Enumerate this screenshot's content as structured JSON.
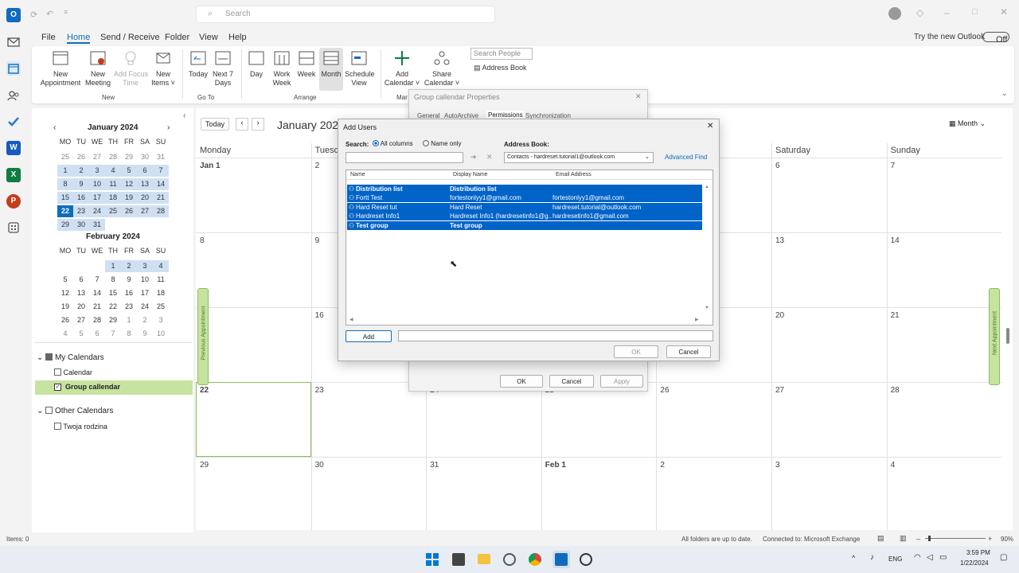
{
  "window": {
    "search_placeholder": "Search"
  },
  "menu": [
    "File",
    "Home",
    "Send / Receive",
    "Folder",
    "View",
    "Help"
  ],
  "try_new": "Try the new Outlook",
  "toggle": "Off",
  "ribbon": {
    "new_appt": "New\nAppointment",
    "new_meeting": "New\nMeeting",
    "focus": "Add Focus\nTime",
    "new_items": "New\nItems ˅",
    "today": "Today",
    "next7": "Next 7\nDays",
    "day": "Day",
    "workweek": "Work\nWeek",
    "week": "Week",
    "month": "Month",
    "schedule": "Schedule\nView",
    "add_cal": "Add\nCalendar ˅",
    "share_cal": "Share\nCalendar ˅",
    "search_people": "Search People",
    "address_book": "Address Book",
    "grp_new": "New",
    "grp_goto": "Go To",
    "grp_arrange": "Arrange",
    "grp_man": "Mar"
  },
  "mini": {
    "jan_title": "January 2024",
    "feb_title": "February 2024",
    "dow": [
      "MO",
      "TU",
      "WE",
      "TH",
      "FR",
      "SA",
      "SU"
    ],
    "jan": [
      "25",
      "26",
      "27",
      "28",
      "29",
      "30",
      "31",
      "1",
      "2",
      "3",
      "4",
      "5",
      "6",
      "7",
      "8",
      "9",
      "10",
      "11",
      "12",
      "13",
      "14",
      "15",
      "16",
      "17",
      "18",
      "19",
      "20",
      "21",
      "22",
      "23",
      "24",
      "25",
      "26",
      "27",
      "28",
      "29",
      "30",
      "31"
    ],
    "feb": [
      "1",
      "2",
      "3",
      "4",
      "5",
      "6",
      "7",
      "8",
      "9",
      "10",
      "11",
      "12",
      "13",
      "14",
      "15",
      "16",
      "17",
      "18",
      "19",
      "20",
      "21",
      "22",
      "23",
      "24",
      "25",
      "26",
      "27",
      "28",
      "29",
      "1",
      "2",
      "3",
      "4",
      "5",
      "6",
      "7",
      "8",
      "9",
      "10"
    ]
  },
  "folders": {
    "my": "My Calendars",
    "calendar": "Calendar",
    "group": "Group callendar",
    "other": "Other Calendars",
    "twoja": "Twoja rodzina"
  },
  "calendar": {
    "today_btn": "Today",
    "title": "January 2024",
    "view": "Month",
    "days": [
      "Monday",
      "Tuesday",
      "",
      "",
      "",
      "Saturday",
      "Sunday"
    ],
    "weeks": [
      [
        "Jan 1",
        "2",
        "",
        "",
        "",
        "6",
        "7"
      ],
      [
        "8",
        "9",
        "",
        "",
        "",
        "13",
        "14"
      ],
      [
        "",
        "16",
        "",
        "",
        "",
        "20",
        "21"
      ],
      [
        "22",
        "23",
        "24",
        "25",
        "26",
        "27",
        "28"
      ],
      [
        "29",
        "30",
        "31",
        "Feb 1",
        "2",
        "3",
        "4"
      ]
    ],
    "prev_appt": "Previous Appointment",
    "next_appt": "Next Appointment"
  },
  "props": {
    "title": "Group callendar Properties",
    "tabs": [
      "General",
      "AutoArchive",
      "Permissions",
      "Synchronization"
    ],
    "ok": "OK",
    "cancel": "Cancel",
    "apply": "Apply"
  },
  "dialog": {
    "title": "Add Users",
    "search_label": "Search:",
    "all_columns": "All columns",
    "name_only": "Name only",
    "address_book_label": "Address Book:",
    "address_book_value": "Contacts - hardreset.tutorial1@outlook.com",
    "advanced_find": "Advanced Find",
    "columns": [
      "Name",
      "Display Name",
      "Email Address"
    ],
    "rows": [
      {
        "name": "Distribution list",
        "display": "Distribution list",
        "email": "",
        "bold": true
      },
      {
        "name": "Fortt Test",
        "display": "fortestonlyy1@gmail.com",
        "email": "fortestonlyy1@gmail.com",
        "bold": false
      },
      {
        "name": "Hard Reset tut",
        "display": "Hard Reset",
        "email": "hardreset.tutorial@outlook.com",
        "bold": false
      },
      {
        "name": "Hardreset Info1",
        "display": "Hardreset Info1 (hardresetinfo1@g...",
        "email": "hardresetinfo1@gmail.com",
        "bold": false
      },
      {
        "name": "Test group",
        "display": "Test group",
        "email": "",
        "bold": true
      }
    ],
    "add": "Add",
    "ok": "OK",
    "cancel": "Cancel"
  },
  "status": {
    "items": "Items: 0",
    "folders": "All folders are up to date.",
    "connected": "Connected to: Microsoft Exchange",
    "zoom": "90%"
  },
  "taskbar": {
    "lang": "ENG",
    "time": "3:59 PM",
    "date": "1/22/2024"
  },
  "colors": {
    "accent": "#0f6cbd",
    "selected": "#0063c7",
    "today_fill": "#0f6cbd",
    "group_hl": "#c6e3a0"
  }
}
